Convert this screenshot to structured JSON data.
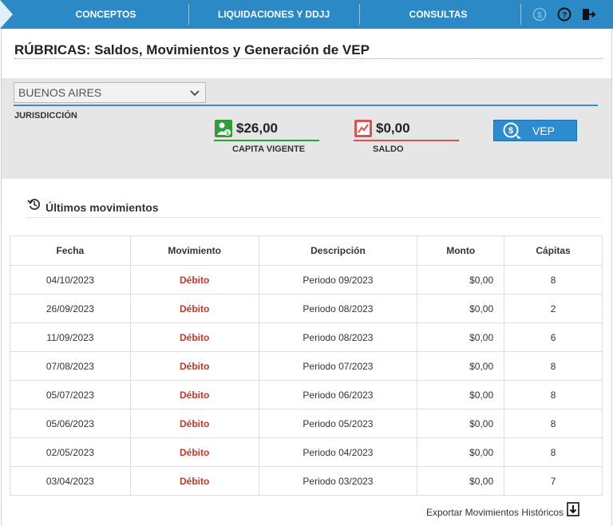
{
  "nav": {
    "items": [
      {
        "label": "CONCEPTOS"
      },
      {
        "label": "LIQUIDACIONES Y DDJJ"
      },
      {
        "label": "CONSULTAS"
      }
    ]
  },
  "page": {
    "title": "RÚBRICAS: Saldos, Movimientos y Generación de VEP"
  },
  "jurisdiction": {
    "selected": "BUENOS AIRES",
    "label": "JURISDICCIÓN"
  },
  "stats": {
    "capita": {
      "amount": "$26,00",
      "label": "CAPITA VIGENTE",
      "color": "#2e9e3a"
    },
    "saldo": {
      "amount": "$0,00",
      "label": "SALDO",
      "color": "#d9534f"
    }
  },
  "vep_button": {
    "label": "VEP"
  },
  "movements": {
    "title": "Últimos movimientos",
    "headers": [
      "Fecha",
      "Movimiento",
      "Descripción",
      "Monto",
      "Cápitas"
    ],
    "rows": [
      [
        "04/10/2023",
        "Débito",
        "Periodo 09/2023",
        "$0,00",
        "8"
      ],
      [
        "26/09/2023",
        "Débito",
        "Periodo 08/2023",
        "$0,00",
        "2"
      ],
      [
        "11/09/2023",
        "Débito",
        "Periodo 08/2023",
        "$0,00",
        "6"
      ],
      [
        "07/08/2023",
        "Débito",
        "Periodo 07/2023",
        "$0,00",
        "8"
      ],
      [
        "05/07/2023",
        "Débito",
        "Periodo 06/2023",
        "$0,00",
        "8"
      ],
      [
        "05/06/2023",
        "Débito",
        "Periodo 05/2023",
        "$0,00",
        "8"
      ],
      [
        "02/05/2023",
        "Débito",
        "Periodo 04/2023",
        "$0,00",
        "8"
      ],
      [
        "03/04/2023",
        "Débito",
        "Periodo 03/2023",
        "$0,00",
        "7"
      ]
    ]
  },
  "export": {
    "label": "Exportar Movimientos Históricos"
  },
  "colors": {
    "nav_bg": "#2b8ac6",
    "accent": "#2d8bd0",
    "debit": "#c0392b"
  }
}
